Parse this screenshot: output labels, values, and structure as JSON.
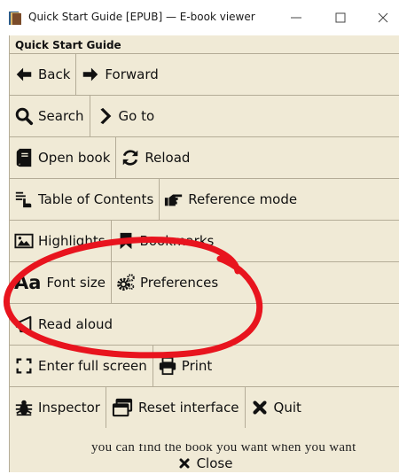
{
  "window": {
    "title": "Quick Start Guide [EPUB] — E-book viewer",
    "icons": [
      "app-book-icon",
      "minimize-icon",
      "maximize-icon",
      "close-window-icon"
    ]
  },
  "menu": {
    "title": "Quick Start Guide",
    "rows": [
      [
        {
          "label": "Back",
          "icon": "arrow-left-icon"
        },
        {
          "label": "Forward",
          "icon": "arrow-right-icon"
        }
      ],
      [
        {
          "label": "Search",
          "icon": "search-icon"
        },
        {
          "label": "Go to",
          "icon": "chevron-right-icon"
        }
      ],
      [
        {
          "label": "Open book",
          "icon": "book-icon"
        },
        {
          "label": "Reload",
          "icon": "reload-icon"
        }
      ],
      [
        {
          "label": "Table of Contents",
          "icon": "toc-icon"
        },
        {
          "label": "Reference mode",
          "icon": "pointing-hand-icon"
        }
      ],
      [
        {
          "label": "Highlights",
          "icon": "image-icon"
        },
        {
          "label": "Bookmarks",
          "icon": "bookmark-icon"
        }
      ],
      [
        {
          "label": "Font size",
          "icon": "font-size-icon"
        },
        {
          "label": "Preferences",
          "icon": "gears-icon"
        }
      ],
      [
        {
          "label": "Read aloud",
          "icon": "megaphone-icon"
        }
      ],
      [
        {
          "label": "Enter full screen",
          "icon": "fullscreen-icon"
        },
        {
          "label": "Print",
          "icon": "print-icon"
        }
      ],
      [
        {
          "label": "Inspector",
          "icon": "bug-icon"
        },
        {
          "label": "Reset interface",
          "icon": "window-icon"
        },
        {
          "label": "Quit",
          "icon": "x-icon"
        }
      ]
    ],
    "font_size_glyph": "Aa",
    "background_text": "you can find the book you want when you want",
    "close_label": "Close"
  },
  "colors": {
    "menu_bg": "#f0ead6",
    "border": "#b4ac97",
    "annotation": "#e8141e"
  }
}
